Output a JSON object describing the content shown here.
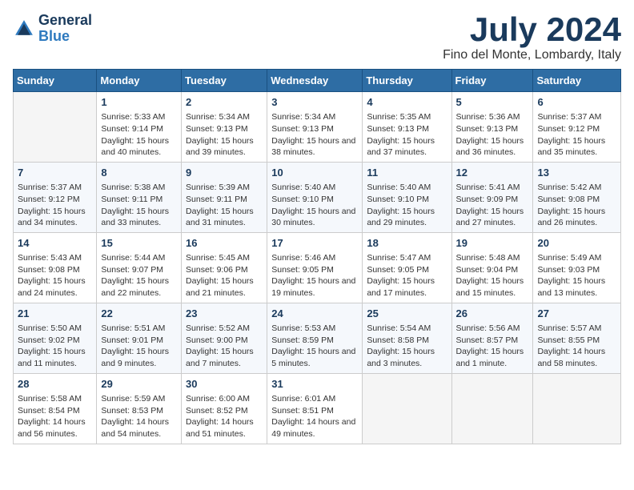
{
  "header": {
    "logo_line1": "General",
    "logo_line2": "Blue",
    "month": "July 2024",
    "location": "Fino del Monte, Lombardy, Italy"
  },
  "weekdays": [
    "Sunday",
    "Monday",
    "Tuesday",
    "Wednesday",
    "Thursday",
    "Friday",
    "Saturday"
  ],
  "weeks": [
    [
      {
        "day": "",
        "empty": true
      },
      {
        "day": "1",
        "sunrise": "Sunrise: 5:33 AM",
        "sunset": "Sunset: 9:14 PM",
        "daylight": "Daylight: 15 hours and 40 minutes."
      },
      {
        "day": "2",
        "sunrise": "Sunrise: 5:34 AM",
        "sunset": "Sunset: 9:13 PM",
        "daylight": "Daylight: 15 hours and 39 minutes."
      },
      {
        "day": "3",
        "sunrise": "Sunrise: 5:34 AM",
        "sunset": "Sunset: 9:13 PM",
        "daylight": "Daylight: 15 hours and 38 minutes."
      },
      {
        "day": "4",
        "sunrise": "Sunrise: 5:35 AM",
        "sunset": "Sunset: 9:13 PM",
        "daylight": "Daylight: 15 hours and 37 minutes."
      },
      {
        "day": "5",
        "sunrise": "Sunrise: 5:36 AM",
        "sunset": "Sunset: 9:13 PM",
        "daylight": "Daylight: 15 hours and 36 minutes."
      },
      {
        "day": "6",
        "sunrise": "Sunrise: 5:37 AM",
        "sunset": "Sunset: 9:12 PM",
        "daylight": "Daylight: 15 hours and 35 minutes."
      }
    ],
    [
      {
        "day": "7",
        "sunrise": "Sunrise: 5:37 AM",
        "sunset": "Sunset: 9:12 PM",
        "daylight": "Daylight: 15 hours and 34 minutes."
      },
      {
        "day": "8",
        "sunrise": "Sunrise: 5:38 AM",
        "sunset": "Sunset: 9:11 PM",
        "daylight": "Daylight: 15 hours and 33 minutes."
      },
      {
        "day": "9",
        "sunrise": "Sunrise: 5:39 AM",
        "sunset": "Sunset: 9:11 PM",
        "daylight": "Daylight: 15 hours and 31 minutes."
      },
      {
        "day": "10",
        "sunrise": "Sunrise: 5:40 AM",
        "sunset": "Sunset: 9:10 PM",
        "daylight": "Daylight: 15 hours and 30 minutes."
      },
      {
        "day": "11",
        "sunrise": "Sunrise: 5:40 AM",
        "sunset": "Sunset: 9:10 PM",
        "daylight": "Daylight: 15 hours and 29 minutes."
      },
      {
        "day": "12",
        "sunrise": "Sunrise: 5:41 AM",
        "sunset": "Sunset: 9:09 PM",
        "daylight": "Daylight: 15 hours and 27 minutes."
      },
      {
        "day": "13",
        "sunrise": "Sunrise: 5:42 AM",
        "sunset": "Sunset: 9:08 PM",
        "daylight": "Daylight: 15 hours and 26 minutes."
      }
    ],
    [
      {
        "day": "14",
        "sunrise": "Sunrise: 5:43 AM",
        "sunset": "Sunset: 9:08 PM",
        "daylight": "Daylight: 15 hours and 24 minutes."
      },
      {
        "day": "15",
        "sunrise": "Sunrise: 5:44 AM",
        "sunset": "Sunset: 9:07 PM",
        "daylight": "Daylight: 15 hours and 22 minutes."
      },
      {
        "day": "16",
        "sunrise": "Sunrise: 5:45 AM",
        "sunset": "Sunset: 9:06 PM",
        "daylight": "Daylight: 15 hours and 21 minutes."
      },
      {
        "day": "17",
        "sunrise": "Sunrise: 5:46 AM",
        "sunset": "Sunset: 9:05 PM",
        "daylight": "Daylight: 15 hours and 19 minutes."
      },
      {
        "day": "18",
        "sunrise": "Sunrise: 5:47 AM",
        "sunset": "Sunset: 9:05 PM",
        "daylight": "Daylight: 15 hours and 17 minutes."
      },
      {
        "day": "19",
        "sunrise": "Sunrise: 5:48 AM",
        "sunset": "Sunset: 9:04 PM",
        "daylight": "Daylight: 15 hours and 15 minutes."
      },
      {
        "day": "20",
        "sunrise": "Sunrise: 5:49 AM",
        "sunset": "Sunset: 9:03 PM",
        "daylight": "Daylight: 15 hours and 13 minutes."
      }
    ],
    [
      {
        "day": "21",
        "sunrise": "Sunrise: 5:50 AM",
        "sunset": "Sunset: 9:02 PM",
        "daylight": "Daylight: 15 hours and 11 minutes."
      },
      {
        "day": "22",
        "sunrise": "Sunrise: 5:51 AM",
        "sunset": "Sunset: 9:01 PM",
        "daylight": "Daylight: 15 hours and 9 minutes."
      },
      {
        "day": "23",
        "sunrise": "Sunrise: 5:52 AM",
        "sunset": "Sunset: 9:00 PM",
        "daylight": "Daylight: 15 hours and 7 minutes."
      },
      {
        "day": "24",
        "sunrise": "Sunrise: 5:53 AM",
        "sunset": "Sunset: 8:59 PM",
        "daylight": "Daylight: 15 hours and 5 minutes."
      },
      {
        "day": "25",
        "sunrise": "Sunrise: 5:54 AM",
        "sunset": "Sunset: 8:58 PM",
        "daylight": "Daylight: 15 hours and 3 minutes."
      },
      {
        "day": "26",
        "sunrise": "Sunrise: 5:56 AM",
        "sunset": "Sunset: 8:57 PM",
        "daylight": "Daylight: 15 hours and 1 minute."
      },
      {
        "day": "27",
        "sunrise": "Sunrise: 5:57 AM",
        "sunset": "Sunset: 8:55 PM",
        "daylight": "Daylight: 14 hours and 58 minutes."
      }
    ],
    [
      {
        "day": "28",
        "sunrise": "Sunrise: 5:58 AM",
        "sunset": "Sunset: 8:54 PM",
        "daylight": "Daylight: 14 hours and 56 minutes."
      },
      {
        "day": "29",
        "sunrise": "Sunrise: 5:59 AM",
        "sunset": "Sunset: 8:53 PM",
        "daylight": "Daylight: 14 hours and 54 minutes."
      },
      {
        "day": "30",
        "sunrise": "Sunrise: 6:00 AM",
        "sunset": "Sunset: 8:52 PM",
        "daylight": "Daylight: 14 hours and 51 minutes."
      },
      {
        "day": "31",
        "sunrise": "Sunrise: 6:01 AM",
        "sunset": "Sunset: 8:51 PM",
        "daylight": "Daylight: 14 hours and 49 minutes."
      },
      {
        "day": "",
        "empty": true
      },
      {
        "day": "",
        "empty": true
      },
      {
        "day": "",
        "empty": true
      }
    ]
  ]
}
